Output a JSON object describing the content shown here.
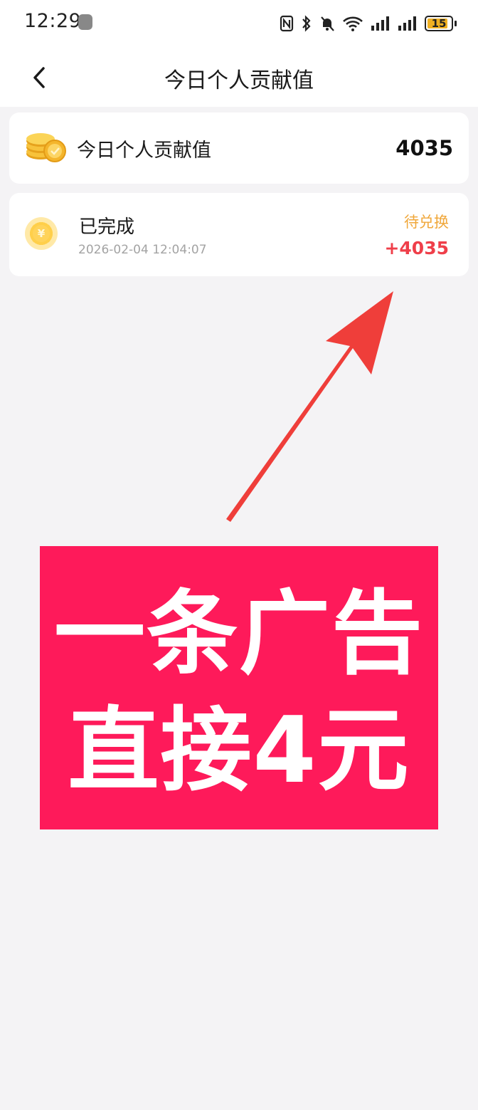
{
  "status_bar": {
    "time": "12:29",
    "battery_level": "15"
  },
  "header": {
    "title": "今日个人贡献值"
  },
  "summary": {
    "label": "今日个人贡献值",
    "value": "4035"
  },
  "record": {
    "icon_glyph": "¥",
    "status": "已完成",
    "timestamp": "2026-02-04 12:04:07",
    "exchange_state": "待兑换",
    "amount": "+4035"
  },
  "promo": {
    "line1": "一条广告",
    "line2": "直接4元"
  },
  "colors": {
    "promo_bg": "#fe1a5a",
    "arrow": "#ef3e3a",
    "exchange_state": "#f0a73a",
    "amount": "#ef3f4a",
    "coin": "#f7c23b"
  },
  "icons": [
    "back-chevron-icon",
    "coin-stack-icon",
    "yuan-coin-icon",
    "nfc-icon",
    "bluetooth-icon",
    "mute-bell-icon",
    "wifi-icon",
    "signal-icon",
    "battery-icon"
  ]
}
